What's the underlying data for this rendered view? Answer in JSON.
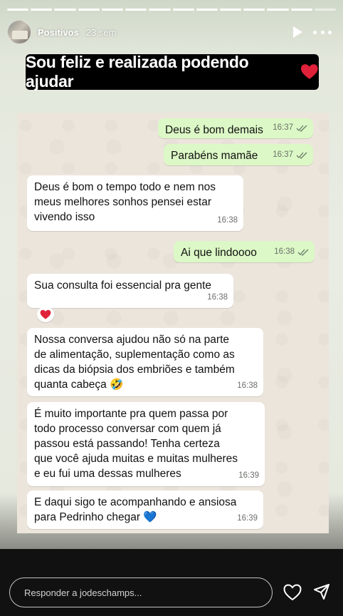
{
  "story": {
    "segments_total": 14,
    "segments_done": 13,
    "username": "Positivos",
    "time_ago": "23 sem",
    "caption": "Sou feliz e realizada podendo ajudar"
  },
  "messages": [
    {
      "direction": "out",
      "text": "Deus é bom demais",
      "time": "16:37",
      "read": true
    },
    {
      "direction": "out",
      "text": "Parabéns mamãe",
      "time": "16:37",
      "read": true
    },
    {
      "direction": "in",
      "lines": [
        "Deus é bom o tempo todo e nem nos",
        "meus melhores sonhos pensei estar",
        "vivendo isso"
      ],
      "time": "16:38"
    },
    {
      "direction": "out",
      "text": "Ai que lindoooo",
      "time": "16:38",
      "read": true
    },
    {
      "direction": "in",
      "text": "Sua consulta foi essencial pra gente",
      "time": "16:38",
      "reaction": "heart"
    },
    {
      "direction": "in",
      "lines": [
        "Nossa conversa ajudou não só na parte",
        "de alimentação, suplementação como as",
        "dicas da biópsia dos embriões e também",
        "quanta cabeça 🤣"
      ],
      "time": "16:38"
    },
    {
      "direction": "in",
      "lines": [
        "É muito importante pra quem passa por",
        "todo processo conversar com quem já",
        "passou está passando! Tenha certeza",
        "que você ajuda muitas e muitas mulheres",
        "e eu fui uma dessas mulheres"
      ],
      "time": "16:39"
    },
    {
      "direction": "in",
      "lines": [
        "E daqui sigo te acompanhando e ansiosa",
        "para Pedrinho chegar 💙"
      ],
      "time": "16:39"
    }
  ],
  "reply": {
    "placeholder": "Responder a jodeschamps..."
  },
  "icons": {
    "play": "play-icon",
    "more": "more-icon",
    "heart": "heart-icon",
    "send": "send-icon",
    "read_ticks": "double-check-icon"
  },
  "colors": {
    "bubble_out": "#dcf8c6",
    "bubble_in": "#ffffff",
    "caption_bg": "#000000",
    "heart": "#e0213a",
    "tick": "#53bdeb"
  }
}
